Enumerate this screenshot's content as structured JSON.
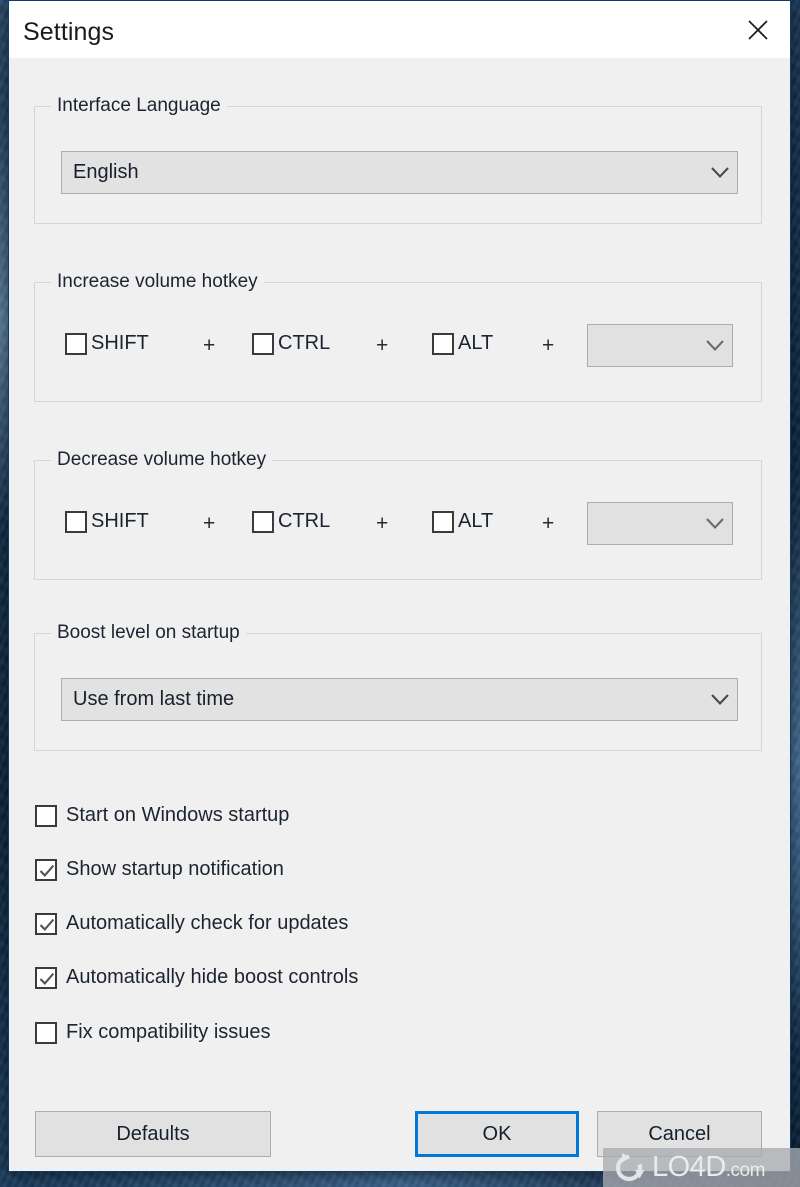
{
  "window": {
    "title": "Settings",
    "close_icon": "close-icon"
  },
  "groups": {
    "language": {
      "title": "Interface Language",
      "combo": {
        "value": "English",
        "chevron_icon": "chevron-down-icon"
      }
    },
    "increase_hotkey": {
      "title": "Increase volume hotkey",
      "modifiers": [
        {
          "label": "SHIFT",
          "checked": false
        },
        {
          "label": "CTRL",
          "checked": false
        },
        {
          "label": "ALT",
          "checked": false
        }
      ],
      "separator": "+",
      "key_combo": {
        "value": "",
        "chevron_icon": "chevron-down-icon"
      }
    },
    "decrease_hotkey": {
      "title": "Decrease volume hotkey",
      "modifiers": [
        {
          "label": "SHIFT",
          "checked": false
        },
        {
          "label": "CTRL",
          "checked": false
        },
        {
          "label": "ALT",
          "checked": false
        }
      ],
      "separator": "+",
      "key_combo": {
        "value": "",
        "chevron_icon": "chevron-down-icon"
      }
    },
    "boost_startup": {
      "title": "Boost level on startup",
      "combo": {
        "value": "Use from last time",
        "chevron_icon": "chevron-down-icon"
      }
    }
  },
  "options": [
    {
      "label": "Start on Windows startup",
      "checked": false
    },
    {
      "label": "Show startup notification",
      "checked": true
    },
    {
      "label": "Automatically check for updates",
      "checked": true
    },
    {
      "label": "Automatically hide boost controls",
      "checked": true
    },
    {
      "label": "Fix compatibility issues",
      "checked": false
    }
  ],
  "buttons": {
    "defaults": "Defaults",
    "ok": "OK",
    "cancel": "Cancel"
  },
  "watermark": {
    "name": "LO4D",
    "domain": ".com"
  },
  "colors": {
    "accent": "#0078d7",
    "window_bg": "#f0f0f0",
    "titlebar_bg": "#ffffff",
    "control_bg": "#e1e1e1",
    "border": "#adadad",
    "group_border": "#d5d5d5",
    "text": "#1b2430"
  }
}
